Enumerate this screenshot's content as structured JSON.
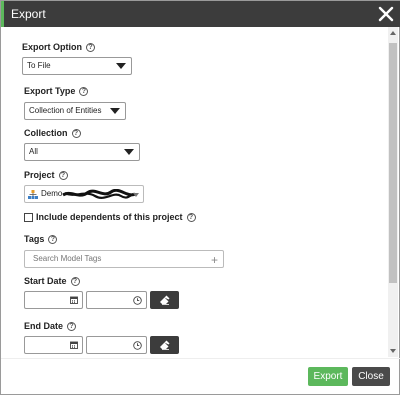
{
  "dialog": {
    "title": "Export",
    "close_icon": "close-icon"
  },
  "form": {
    "export_option": {
      "label": "Export Option",
      "value": "To File"
    },
    "export_type": {
      "label": "Export Type",
      "value": "Collection of Entities"
    },
    "collection": {
      "label": "Collection",
      "value": "All"
    },
    "project": {
      "label": "Project",
      "value": "Demo"
    },
    "include_dependents": {
      "label": "Include dependents of this project",
      "checked": false
    },
    "tags": {
      "label": "Tags",
      "placeholder": "Search Model Tags"
    },
    "start_date": {
      "label": "Start Date"
    },
    "end_date": {
      "label": "End Date"
    }
  },
  "footer": {
    "export_label": "Export",
    "close_label": "Close"
  },
  "colors": {
    "titlebar": "#3c3c3c",
    "accent": "#5cb85c",
    "export_button": "#5cb85c",
    "close_button": "#4a4a4a"
  }
}
